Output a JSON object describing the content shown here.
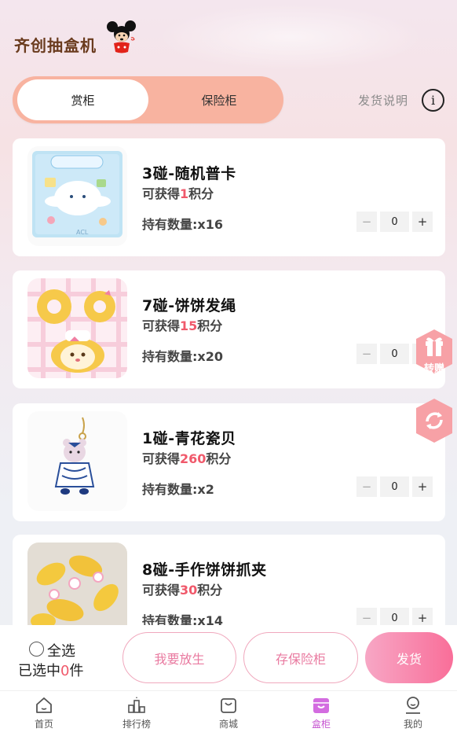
{
  "header": {
    "brand": "齐创抽盒机"
  },
  "segment": {
    "tabs": [
      "赏柜",
      "保险柜"
    ],
    "active_index": 0
  },
  "ship_help": {
    "label": "发货说明"
  },
  "items": [
    {
      "name": "3碰-随机普卡",
      "points_prefix": "可获得",
      "points": "1",
      "points_suffix": "积分",
      "qty_label": "持有数量:x16",
      "stepper_value": "0"
    },
    {
      "name": "7碰-饼饼发绳",
      "points_prefix": "可获得",
      "points": "15",
      "points_suffix": "积分",
      "qty_label": "持有数量:x20",
      "stepper_value": "0"
    },
    {
      "name": "1碰-青花瓷贝",
      "points_prefix": "可获得",
      "points": "260",
      "points_suffix": "积分",
      "qty_label": "持有数量:x2",
      "stepper_value": "0"
    },
    {
      "name": "8碰-手作饼饼抓夹",
      "points_prefix": "可获得",
      "points": "30",
      "points_suffix": "积分",
      "qty_label": "持有数量:x14",
      "stepper_value": "0"
    }
  ],
  "stepper": {
    "minus": "−",
    "plus": "+"
  },
  "floating": {
    "gift_label": "转赠"
  },
  "actionbar": {
    "select_all": "全选",
    "selected_prefix": "已选中",
    "selected_count": "0",
    "selected_suffix": "件",
    "release_label": "我要放生",
    "store_label": "存保险柜",
    "ship_label": "发货"
  },
  "tabbar": {
    "tabs": [
      {
        "label": "首页",
        "icon": "home-icon"
      },
      {
        "label": "排行榜",
        "icon": "podium-icon"
      },
      {
        "label": "商城",
        "icon": "shopping-bag-icon"
      },
      {
        "label": "盒柜",
        "icon": "box-cabinet-icon"
      },
      {
        "label": "我的",
        "icon": "user-icon"
      }
    ],
    "active_index": 3
  },
  "colors": {
    "accent": "#f96e99",
    "points": "#f0596b",
    "segment_bg": "#f8b3a0",
    "active_tab": "#c654d0"
  }
}
